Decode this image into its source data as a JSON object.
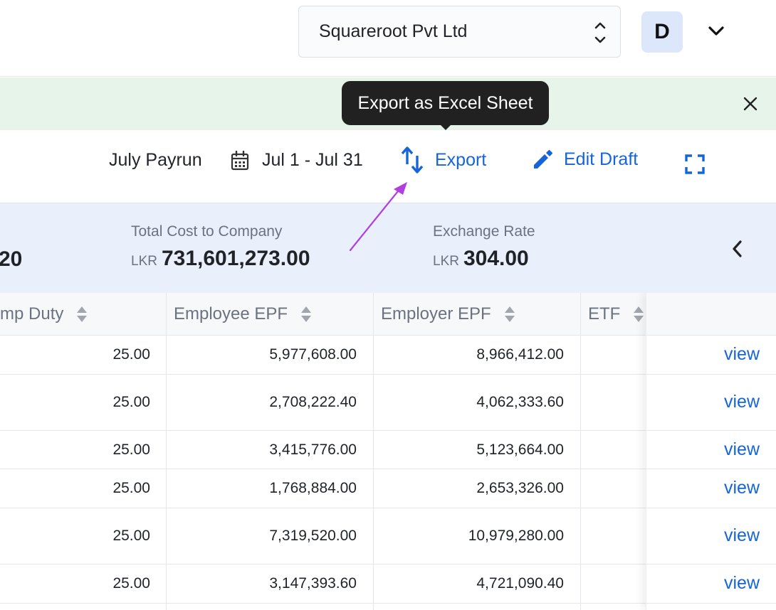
{
  "header": {
    "company_name": "Squareroot Pvt Ltd",
    "avatar_initial": "D"
  },
  "tooltip": {
    "text": "Export as Excel Sheet"
  },
  "actions": {
    "payrun_name": "July Payrun",
    "date_range": "Jul 1 - Jul 31",
    "export_label": "Export",
    "edit_label": "Edit Draft"
  },
  "summary": {
    "partial_value": "20",
    "items": [
      {
        "label": "Total Cost to Company",
        "currency": "LKR",
        "value": "731,601,273.00"
      },
      {
        "label": "Exchange Rate",
        "currency": "LKR",
        "value": "304.00"
      }
    ]
  },
  "table": {
    "columns": [
      "mp Duty",
      "Employee EPF",
      "Employer EPF",
      "ETF"
    ],
    "rows": [
      {
        "stamp_duty": "25.00",
        "employee_epf": "5,977,608.00",
        "employer_epf": "8,966,412.00",
        "action": "view"
      },
      {
        "stamp_duty": "25.00",
        "employee_epf": "2,708,222.40",
        "employer_epf": "4,062,333.60",
        "action": "view"
      },
      {
        "stamp_duty": "25.00",
        "employee_epf": "3,415,776.00",
        "employer_epf": "5,123,664.00",
        "action": "view"
      },
      {
        "stamp_duty": "25.00",
        "employee_epf": "1,768,884.00",
        "employer_epf": "2,653,326.00",
        "action": "view"
      },
      {
        "stamp_duty": "25.00",
        "employee_epf": "7,319,520.00",
        "employer_epf": "10,979,280.00",
        "action": "view"
      },
      {
        "stamp_duty": "25.00",
        "employee_epf": "3,147,393.60",
        "employer_epf": "4,721,090.40",
        "action": "view"
      }
    ]
  },
  "colors": {
    "accent": "#1565d8",
    "banner_bg": "#e7f4ea",
    "summary_bg": "#e9effb",
    "tooltip_bg": "#212121",
    "annotation_arrow": "#b03ee0"
  },
  "icons": {
    "company_select": "updown-chevron-icon",
    "user_menu": "chevron-down-icon",
    "banner": "close-icon",
    "date": "calendar-icon",
    "export": "swap-vertical-icon",
    "edit": "pencil-icon",
    "view_mode": "fullscreen-icon",
    "summary_nav": "chevron-left-icon",
    "sort": "sort-icon"
  }
}
